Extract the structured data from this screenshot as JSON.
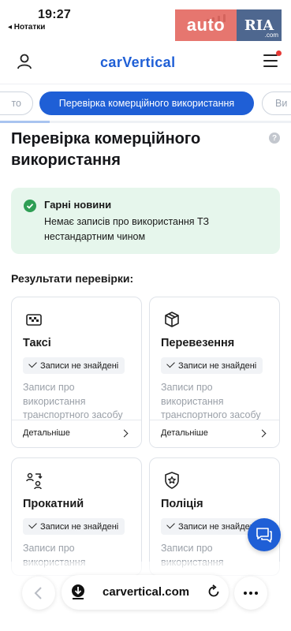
{
  "status_bar": {
    "time": "19:27",
    "back_app": "◂ Нотатки"
  },
  "watermark": {
    "part1": "auto",
    "part2": "RIA",
    "part3": ".com"
  },
  "header": {
    "logo": "carVertical"
  },
  "tabs": [
    {
      "label": "то"
    },
    {
      "label": "Перевірка комерційного використання",
      "active": true
    },
    {
      "label": "Ви"
    }
  ],
  "progress": {
    "fraction": 0.17
  },
  "main": {
    "title": "Перевірка комерційного використання",
    "help": "?"
  },
  "good_news": {
    "title": "Гарні новини",
    "text": "Немає записів про використання ТЗ нестандартним чином"
  },
  "results_heading": "Результати перевірки:",
  "cards": [
    {
      "icon": "taxi-icon",
      "title": "Таксі",
      "badge": "Записи не знайдені",
      "desc": "Записи про використання транспортного засобу",
      "more": "Детальніше"
    },
    {
      "icon": "box-icon",
      "title": "Перевезення",
      "badge": "Записи не знайдені",
      "desc": "Записи про використання транспортного засобу",
      "more": "Детальніше"
    },
    {
      "icon": "rental-icon",
      "title": "Прокатний",
      "badge": "Записи не знайдені",
      "desc": "Записи про використання"
    },
    {
      "icon": "police-badge-icon",
      "title": "Поліція",
      "badge": "Записи не знайдені",
      "desc": "Записи про використання"
    }
  ],
  "browser": {
    "url": "carvertical.com"
  },
  "colors": {
    "brand": "#1f5fd6",
    "success": "#2e9e54",
    "success_bg": "#e6f6ec"
  }
}
